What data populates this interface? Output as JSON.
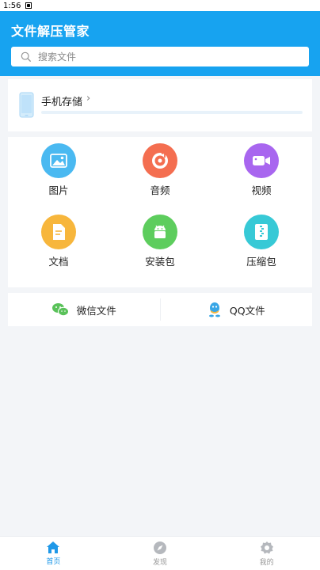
{
  "status": {
    "time": "1:56"
  },
  "header": {
    "title": "文件解压管家"
  },
  "search": {
    "placeholder": "搜索文件"
  },
  "storage": {
    "label": "手机存储",
    "chevron": "›",
    "usage_fraction": 0
  },
  "categories": [
    {
      "label": "图片",
      "icon": "image-icon",
      "color": "#4ab9f1"
    },
    {
      "label": "音频",
      "icon": "audio-icon",
      "color": "#f46e50"
    },
    {
      "label": "视频",
      "icon": "video-icon",
      "color": "#a866ef"
    },
    {
      "label": "文档",
      "icon": "document-icon",
      "color": "#f7b63c"
    },
    {
      "label": "安装包",
      "icon": "android-icon",
      "color": "#5dcd5d"
    },
    {
      "label": "压缩包",
      "icon": "zip-icon",
      "color": "#37c9d6"
    }
  ],
  "quick": [
    {
      "label": "微信文件",
      "icon": "wechat-icon",
      "color": "#5ac25a"
    },
    {
      "label": "QQ文件",
      "icon": "qq-icon",
      "color": "#39a6e6"
    }
  ],
  "nav": [
    {
      "label": "首页",
      "icon": "home-icon",
      "active": true
    },
    {
      "label": "发现",
      "icon": "compass-icon",
      "active": false
    },
    {
      "label": "我的",
      "icon": "gear-icon",
      "active": false
    }
  ],
  "colors": {
    "primary": "#17a3f0",
    "active_tab": "#1f98e8"
  }
}
